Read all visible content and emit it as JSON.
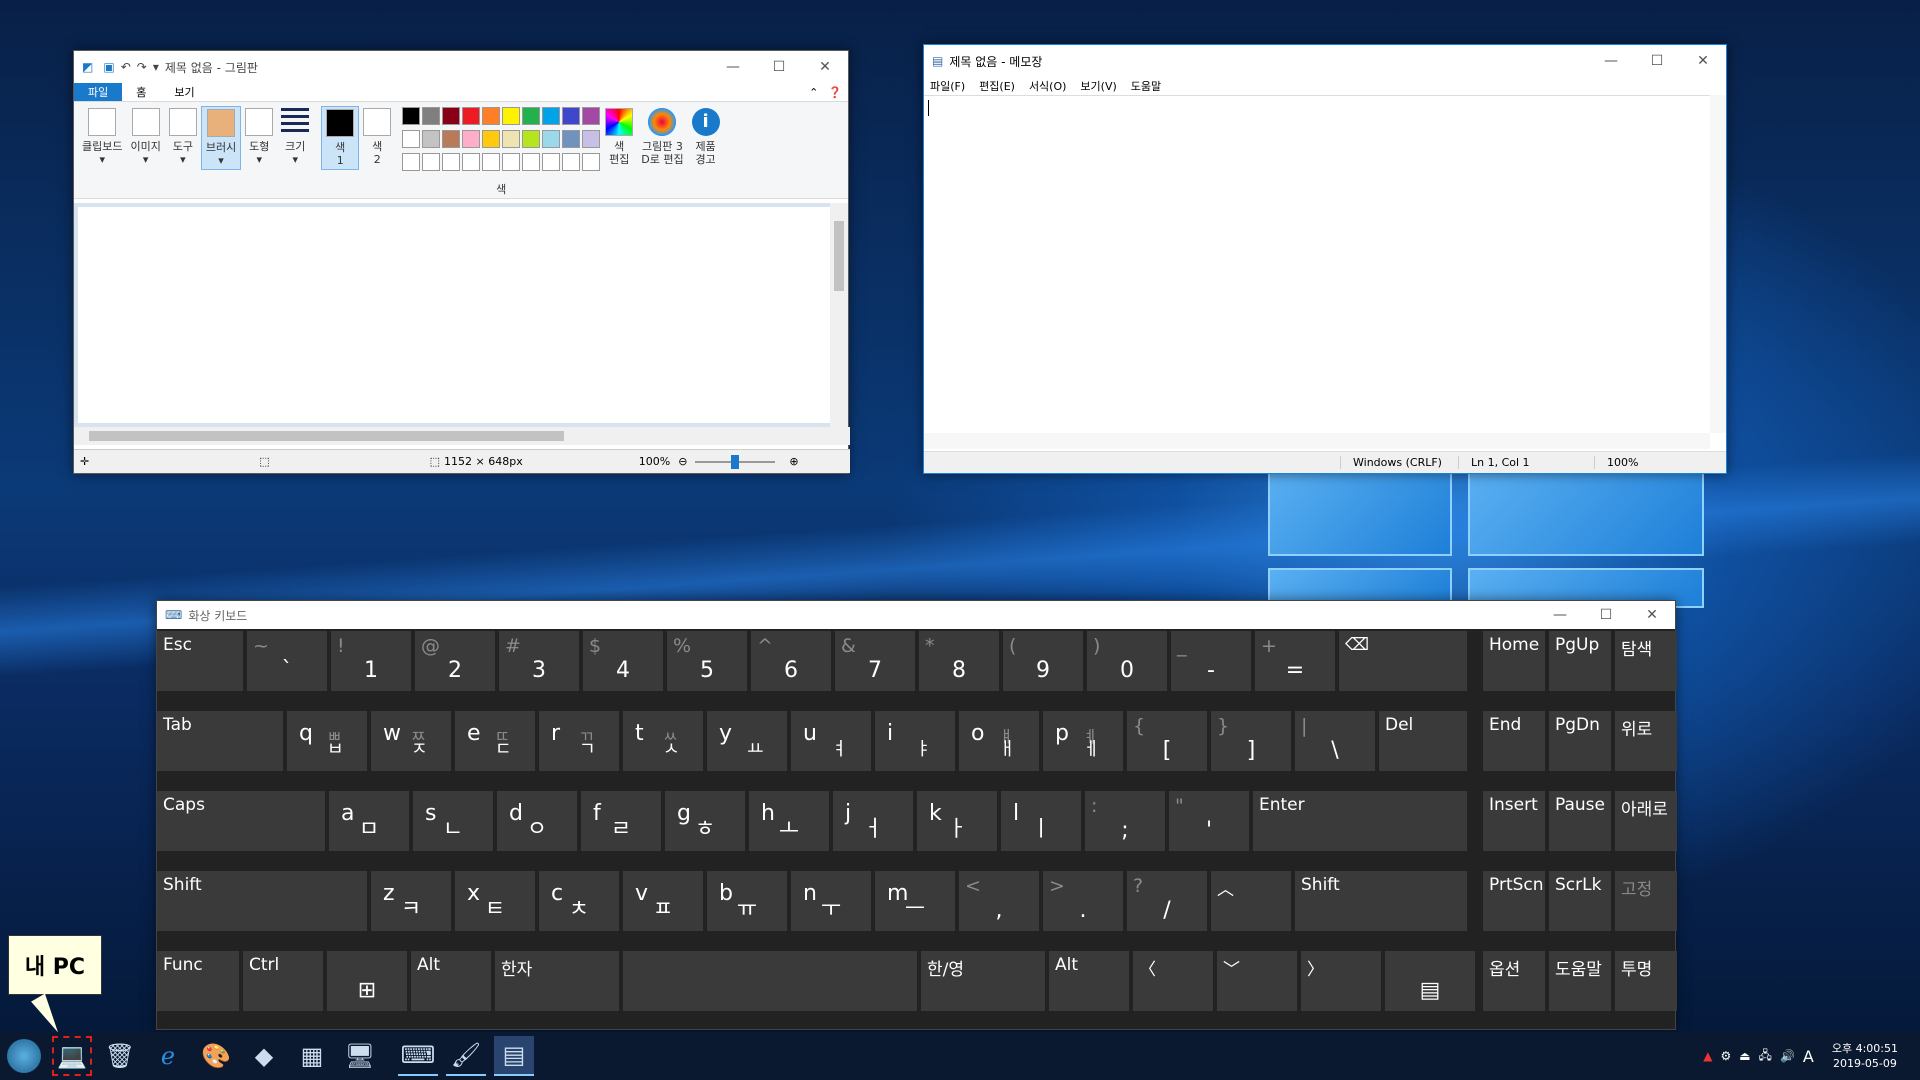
{
  "paint": {
    "title": "제목 없음 - 그림판",
    "tabs": [
      "파일",
      "홈",
      "보기"
    ],
    "groups": [
      "클립보드",
      "이미지",
      "도구",
      "브러시",
      "도형",
      "크기"
    ],
    "color1": "색\n1",
    "color2": "색\n2",
    "colors_label": "색",
    "edit_colors": "색\n편집",
    "paint3d": "그림판 3\nD로 편집",
    "product_alert": "제품\n경고",
    "palette_row1": [
      "#000000",
      "#7f7f7f",
      "#880015",
      "#ed1c24",
      "#ff7f27",
      "#fff200",
      "#22b14c",
      "#00a2e8",
      "#3f48cc",
      "#a349a4"
    ],
    "palette_row2": [
      "#ffffff",
      "#c3c3c3",
      "#b97a57",
      "#ffaec9",
      "#ffc90e",
      "#efe4b0",
      "#b5e61d",
      "#99d9ea",
      "#7092be",
      "#c8bfe7"
    ],
    "status": {
      "dimensions": "1152 × 648px",
      "zoom": "100%"
    }
  },
  "notepad": {
    "title": "제목 없음 - 메모장",
    "menu": [
      "파일(F)",
      "편집(E)",
      "서식(O)",
      "보기(V)",
      "도움말"
    ],
    "status": {
      "eol": "Windows (CRLF)",
      "pos": "Ln 1, Col 1",
      "zoom": "100%"
    }
  },
  "osk": {
    "title": "화상 키보드",
    "row1": [
      [
        "~",
        "`"
      ],
      [
        "!",
        "1"
      ],
      [
        "@",
        "2"
      ],
      [
        "#",
        "3"
      ],
      [
        "$",
        "4"
      ],
      [
        "%",
        "5"
      ],
      [
        "^",
        "6"
      ],
      [
        "&",
        "7"
      ],
      [
        "*",
        "8"
      ],
      [
        "(",
        "9"
      ],
      [
        ")",
        "0"
      ],
      [
        "_",
        "-"
      ],
      [
        "+",
        "="
      ]
    ],
    "row2": [
      [
        "q",
        "ㅃ",
        "ㅂ"
      ],
      [
        "w",
        "ㅉ",
        "ㅈ"
      ],
      [
        "e",
        "ㄸ",
        "ㄷ"
      ],
      [
        "r",
        "ㄲ",
        "ㄱ"
      ],
      [
        "t",
        "ㅆ",
        "ㅅ"
      ],
      [
        "y",
        "",
        "ㅛ"
      ],
      [
        "u",
        "",
        "ㅕ"
      ],
      [
        "i",
        "",
        "ㅑ"
      ],
      [
        "o",
        "ㅒ",
        "ㅐ"
      ],
      [
        "p",
        "ㅖ",
        "ㅔ"
      ]
    ],
    "row2b": [
      [
        "{",
        "["
      ],
      [
        "}",
        "]"
      ],
      [
        "|",
        "\\"
      ]
    ],
    "row3": [
      [
        "a",
        "",
        "ㅁ"
      ],
      [
        "s",
        "",
        "ㄴ"
      ],
      [
        "d",
        "",
        "ㅇ"
      ],
      [
        "f",
        "",
        "ㄹ"
      ],
      [
        "g",
        "",
        "ㅎ"
      ],
      [
        "h",
        "",
        "ㅗ"
      ],
      [
        "j",
        "",
        "ㅓ"
      ],
      [
        "k",
        "",
        "ㅏ"
      ],
      [
        "l",
        "",
        "ㅣ"
      ]
    ],
    "row3b": [
      [
        ":",
        ";"
      ],
      [
        "\"",
        "'"
      ]
    ],
    "row4": [
      [
        "z",
        "",
        "ㅋ"
      ],
      [
        "x",
        "",
        "ㅌ"
      ],
      [
        "c",
        "",
        "ㅊ"
      ],
      [
        "v",
        "",
        "ㅍ"
      ],
      [
        "b",
        "",
        "ㅠ"
      ],
      [
        "n",
        "",
        "ㅜ"
      ],
      [
        "m",
        "",
        "ㅡ"
      ]
    ],
    "row4b": [
      [
        "<",
        ","
      ],
      [
        ">",
        "."
      ],
      [
        "?",
        "/"
      ]
    ],
    "esc": "Esc",
    "tab": "Tab",
    "caps": "Caps",
    "shift": "Shift",
    "shift_r": "Shift",
    "enter": "Enter",
    "func": "Func",
    "ctrl": "Ctrl",
    "alt": "Alt",
    "alt_r": "Alt",
    "hanja": "한자",
    "hanyeong": "한/영",
    "del": "Del",
    "nav": [
      "Home",
      "PgUp",
      "탐색",
      "End",
      "PgDn",
      "위로",
      "Insert",
      "Pause",
      "아래로",
      "PrtScn",
      "ScrLk",
      "고정",
      "옵션",
      "도움말",
      "투명"
    ]
  },
  "tooltip": "내 PC",
  "clock": {
    "time": "오후 4:00:51",
    "date": "2019-05-09"
  },
  "ime": "A"
}
